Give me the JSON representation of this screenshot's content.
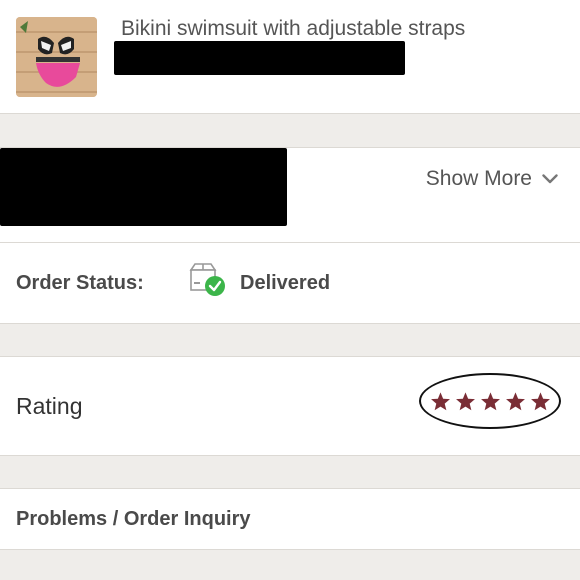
{
  "product": {
    "title": "Bikini swimsuit with adjustable straps"
  },
  "details": {
    "show_more_label": "Show More"
  },
  "order_status": {
    "label": "Order Status:",
    "value": "Delivered",
    "icon": "delivered-box-icon"
  },
  "rating": {
    "label": "Rating",
    "stars": 5,
    "max_stars": 5,
    "star_color": "#7a2d35"
  },
  "problems": {
    "label": "Problems / Order Inquiry"
  },
  "colors": {
    "background": "#efedea",
    "check_green": "#3cb54a"
  }
}
